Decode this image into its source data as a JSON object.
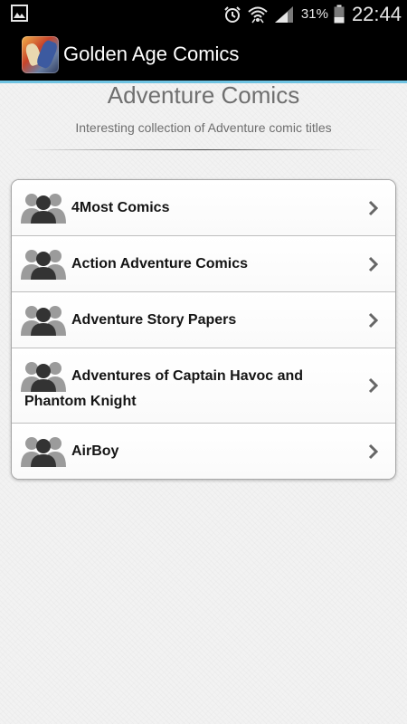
{
  "status_bar": {
    "battery_percent": "31%",
    "time": "22:44",
    "icons": [
      "gallery-icon",
      "alarm-icon",
      "wifi-icon",
      "signal-icon",
      "battery-icon"
    ]
  },
  "action_bar": {
    "app_icon": "golden-age-comics-app-icon",
    "title": "Golden Age Comics",
    "accent_color": "#6fc3e2"
  },
  "header": {
    "title": "Adventure Comics",
    "subtitle": "Interesting collection of Adventure comic titles"
  },
  "list": {
    "item_icon": "people-icon",
    "chevron_icon": "chevron-right-icon",
    "items": [
      {
        "label": "4Most Comics"
      },
      {
        "label": "Action Adventure Comics"
      },
      {
        "label": "Adventure Story Papers"
      },
      {
        "label": "Adventures of Captain Havoc and Phantom Knight"
      },
      {
        "label": "AirBoy"
      }
    ]
  }
}
